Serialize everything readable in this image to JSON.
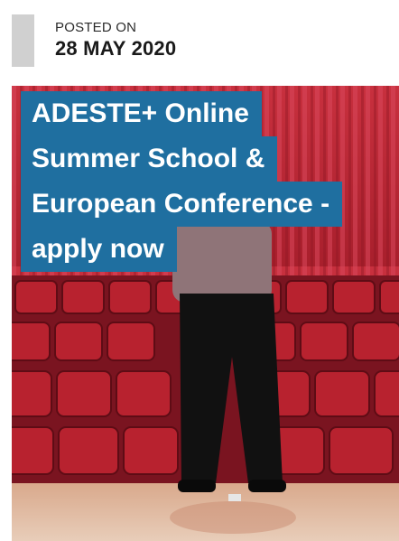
{
  "post": {
    "posted_label": "POSTED ON",
    "date": "28 MAY 2020"
  },
  "featured": {
    "title_lines": [
      "ADESTE+ Online",
      "Summer School &",
      "European Conference -",
      "apply now"
    ],
    "image_icon": "photo-icon"
  },
  "colors": {
    "accent_blue": "#1f6fa0",
    "date_bar": "#d0d0d0",
    "seat_red": "#b8222f"
  }
}
